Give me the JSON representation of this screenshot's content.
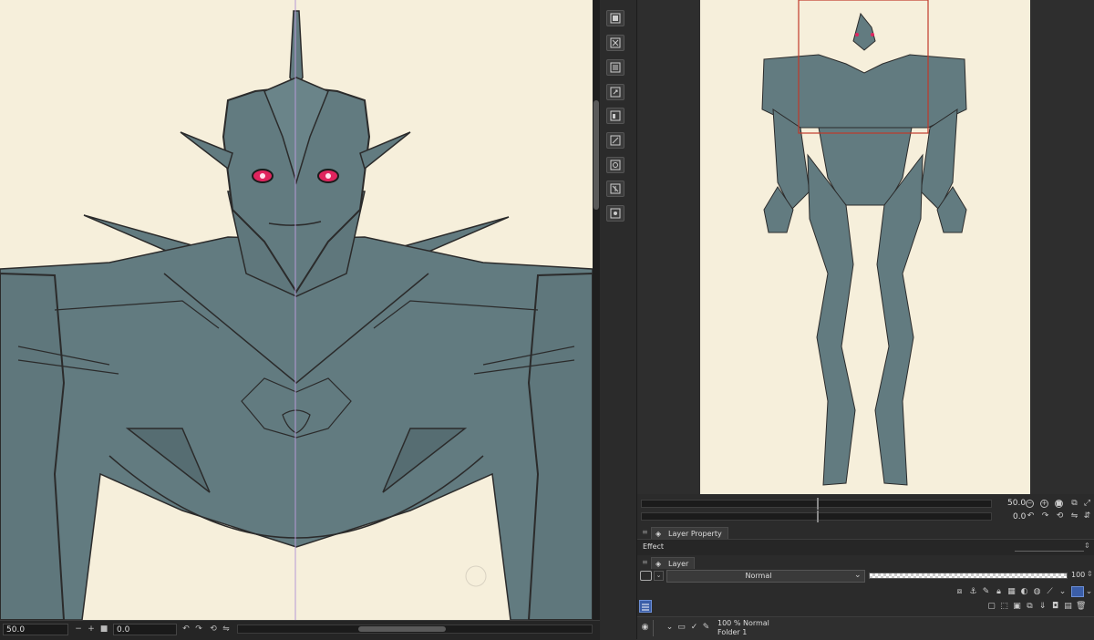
{
  "status_bar": {
    "zoom_value": "50.0",
    "angle_value": "0.0"
  },
  "navigator": {
    "zoom_value": "50.0",
    "angle_value": "0.0"
  },
  "layer_property_panel": {
    "tab_label": "Layer Property",
    "effect_label": "Effect"
  },
  "layer_panel": {
    "tab_label": "Layer",
    "blend_mode": "Normal",
    "opacity_value": "100",
    "layers": [
      {
        "mode": "100 % Normal",
        "name": "Folder 1"
      }
    ]
  },
  "colors": {
    "canvas_paper": "#f6efdb",
    "figure_fill": "#627b80",
    "eye_glow": "#e0245e",
    "navigator_frame": "#c0392b",
    "ui_dark": "#2b2b2b"
  }
}
